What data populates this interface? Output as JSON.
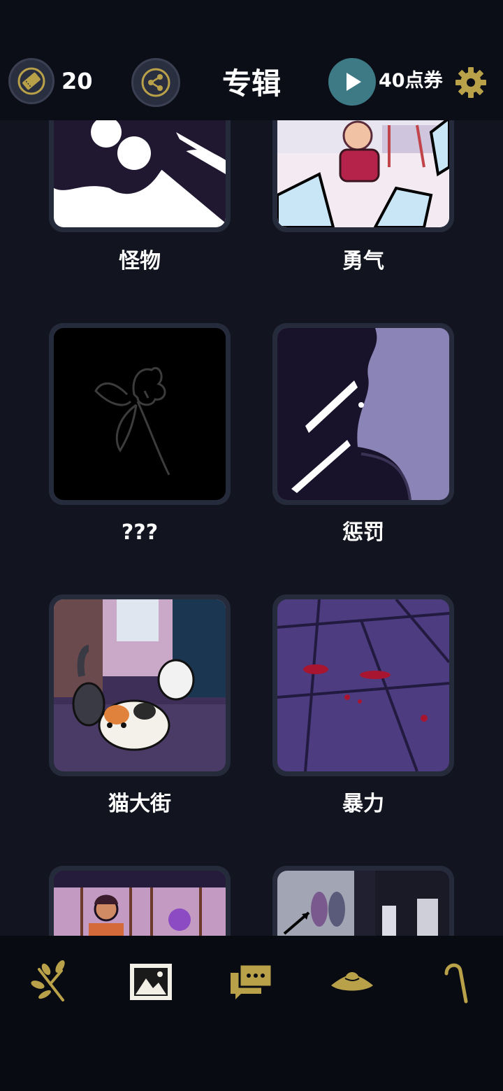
{
  "header": {
    "ticket_count": "20",
    "title": "专辑",
    "coupon_label": "40点券"
  },
  "albums": [
    {
      "label": "怪物",
      "icon": "monster-art"
    },
    {
      "label": "勇气",
      "icon": "courage-art"
    },
    {
      "label": "???",
      "icon": "locked-flower-art"
    },
    {
      "label": "惩罚",
      "icon": "punishment-art"
    },
    {
      "label": "猫大街",
      "icon": "cat-street-art"
    },
    {
      "label": "暴力",
      "icon": "violence-art"
    },
    {
      "label": "",
      "icon": "classroom-art"
    },
    {
      "label": "",
      "icon": "shoes-art"
    }
  ],
  "bottom_nav": [
    {
      "icon": "branch-icon",
      "active": false
    },
    {
      "icon": "gallery-icon",
      "active": true
    },
    {
      "icon": "messages-icon",
      "active": false
    },
    {
      "icon": "hat-icon",
      "active": false
    },
    {
      "icon": "cane-icon",
      "active": false
    }
  ],
  "colors": {
    "background": "#12151f",
    "header": "#0b0e16",
    "accent_gold": "#b9a14a",
    "play_teal": "#3e7a86"
  }
}
